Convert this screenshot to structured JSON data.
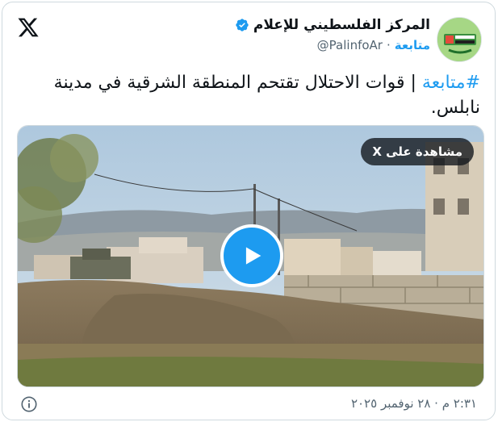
{
  "tweet": {
    "author": {
      "display_name": "المركز الفلسطيني للإعلام",
      "handle": "@PalinfoAr",
      "verified": true,
      "avatar_icon": "palinfo-logo-icon"
    },
    "follow_label": "متابعة",
    "separator": "·",
    "hashtag": "#متابعة",
    "text_body": " | قوات الاحتلال تقتحم المنطقة الشرقية في مدينة نابلس.",
    "media": {
      "watch_label": "مشاهدة على X",
      "play_icon": "play-icon"
    },
    "timestamp": "٢:٣١ م · ٢٨ نوفمبر ٢٠٢٥",
    "info_icon": "info-icon",
    "logo_icon": "x-logo-icon"
  },
  "colors": {
    "accent": "#1d9bf0",
    "secondary_text": "#536471",
    "text": "#0f1419",
    "border": "#cfd9de"
  }
}
